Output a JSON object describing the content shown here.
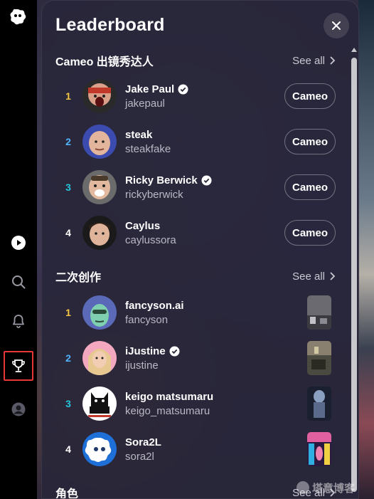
{
  "rail": {
    "icons": [
      "app-logo-icon",
      "video-play-icon",
      "search-icon",
      "bell-icon",
      "trophy-icon",
      "profile-icon"
    ]
  },
  "panel": {
    "title": "Leaderboard",
    "close_label": "close"
  },
  "sections": [
    {
      "title": "Cameo 出镜秀达人",
      "see_all": "See all",
      "items": [
        {
          "rank": "1",
          "name": "Jake Paul",
          "handle": "jakepaul",
          "verified": true,
          "button": "Cameo",
          "rank_color": "#f5c542"
        },
        {
          "rank": "2",
          "name": "steak",
          "handle": "steakfake",
          "verified": false,
          "button": "Cameo",
          "rank_color": "#4fb3ff"
        },
        {
          "rank": "3",
          "name": "Ricky Berwick",
          "handle": "rickyberwick",
          "verified": true,
          "button": "Cameo",
          "rank_color": "#26c6da"
        },
        {
          "rank": "4",
          "name": "Caylus",
          "handle": "caylussora",
          "verified": false,
          "button": "Cameo",
          "rank_color": "#ffffff"
        }
      ]
    },
    {
      "title": "二次创作",
      "see_all": "See all",
      "items": [
        {
          "rank": "1",
          "name": "fancyson.ai",
          "handle": "fancyson",
          "verified": false,
          "rank_color": "#f5c542"
        },
        {
          "rank": "2",
          "name": "iJustine",
          "handle": "ijustine",
          "verified": true,
          "rank_color": "#4fb3ff"
        },
        {
          "rank": "3",
          "name": "keigo matsumaru",
          "handle": "keigo_matsumaru",
          "verified": false,
          "rank_color": "#26c6da"
        },
        {
          "rank": "4",
          "name": "Sora2L",
          "handle": "sora2l",
          "verified": false,
          "rank_color": "#ffffff"
        }
      ]
    },
    {
      "title": "角色",
      "see_all": "See all"
    }
  ],
  "watermark": {
    "text": "塔意博客"
  }
}
